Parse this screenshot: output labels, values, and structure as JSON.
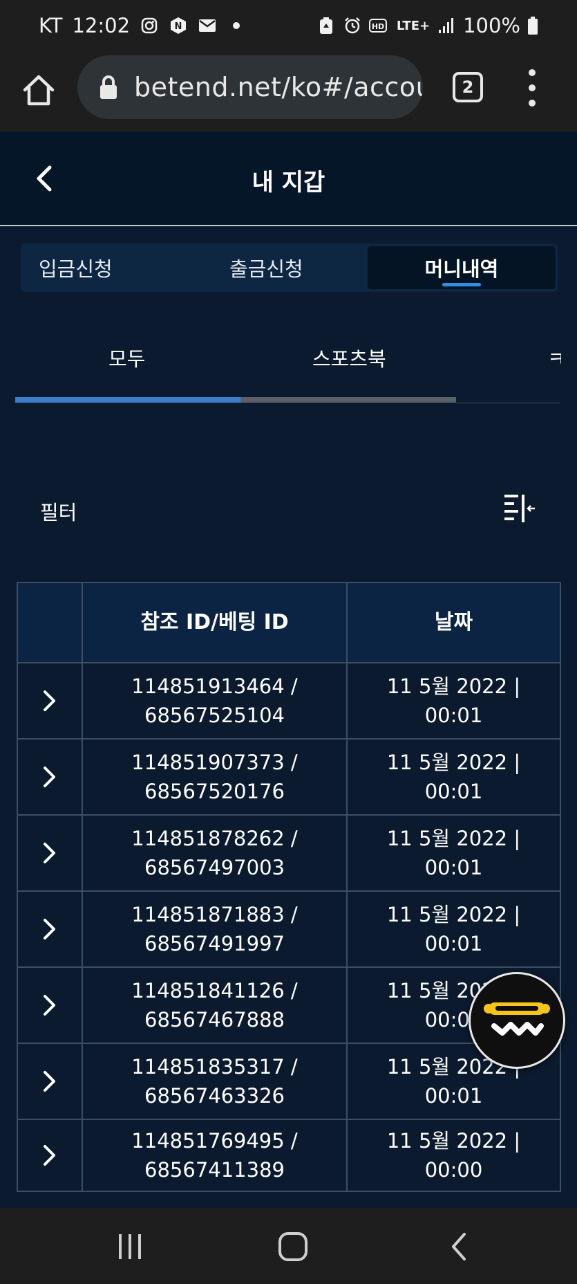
{
  "status_bar": {
    "carrier": "KT",
    "time": "12:02",
    "battery": "100%",
    "network": "LTE+",
    "left_icons": [
      "instagram-icon",
      "naver-icon",
      "mail-icon",
      "dot-icon"
    ],
    "right_icons": [
      "recycle-icon",
      "alarm-icon",
      "hd-icon",
      "lte-icon",
      "signal-icon",
      "battery-icon"
    ]
  },
  "browser": {
    "url": "betend.net/ko#/accou",
    "tab_count": "2"
  },
  "header": {
    "title": "내 지갑"
  },
  "segment_tabs": [
    {
      "label": "입금신청",
      "active": false
    },
    {
      "label": "출금신청",
      "active": false
    },
    {
      "label": "머니내역",
      "active": true
    }
  ],
  "sub_tabs": [
    {
      "label": "모두",
      "active": true
    },
    {
      "label": "스포츠북",
      "active": false
    },
    {
      "label": "ㅋ",
      "active": false
    }
  ],
  "filter": {
    "label": "필터"
  },
  "table": {
    "columns": [
      "",
      "참조 ID/베팅 ID",
      "날짜"
    ],
    "rows": [
      {
        "ref_id": "114851913464 /",
        "bet_id": "68567525104",
        "date": "11 5월 2022 |",
        "time": "00:01"
      },
      {
        "ref_id": "114851907373 /",
        "bet_id": "68567520176",
        "date": "11 5월 2022 |",
        "time": "00:01"
      },
      {
        "ref_id": "114851878262 /",
        "bet_id": "68567497003",
        "date": "11 5월 2022 |",
        "time": "00:01"
      },
      {
        "ref_id": "114851871883 /",
        "bet_id": "68567491997",
        "date": "11 5월 2022 |",
        "time": "00:01"
      },
      {
        "ref_id": "114851841126 /",
        "bet_id": "68567467888",
        "date": "11 5월 2022 |",
        "time": "00:01"
      },
      {
        "ref_id": "114851835317 /",
        "bet_id": "68567463326",
        "date": "11 5월 2022 |",
        "time": "00:01"
      },
      {
        "ref_id": "114851769495 /",
        "bet_id": "68567411389",
        "date": "11 5월 2022 |",
        "time": "00:00"
      }
    ]
  },
  "colors": {
    "background": "#0b1a2e",
    "header_bg": "#061629",
    "accent": "#2f8fe8",
    "table_header": "#0c2443",
    "fab_yellow": "#f5c518"
  }
}
